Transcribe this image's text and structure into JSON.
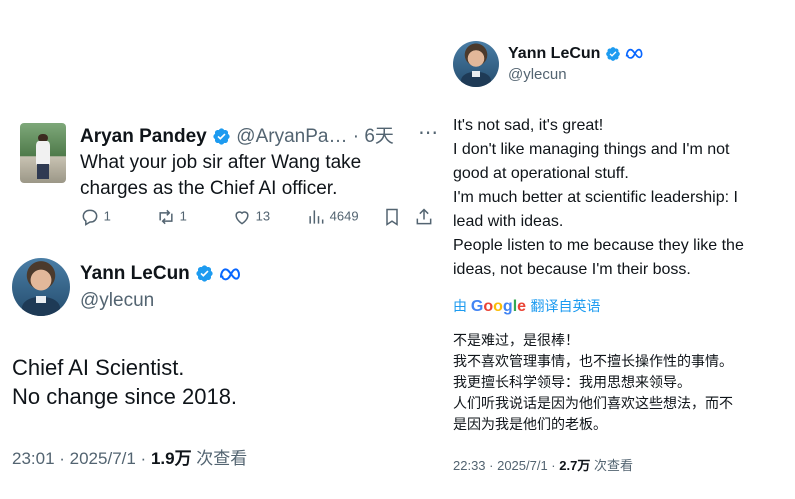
{
  "left": {
    "reply": {
      "name": "Aryan Pandey",
      "handle_time": "@AryanPa… · 6天",
      "text_line1": "What your job sir after Wang take",
      "text_line2": "charges as the Chief AI officer.",
      "stats": {
        "replies": "1",
        "reposts": "1",
        "likes": "13",
        "views": "4649"
      }
    },
    "main": {
      "name": "Yann LeCun",
      "handle": "@ylecun",
      "text_line1": "Chief AI Scientist.",
      "text_line2": "No change since 2018.",
      "meta_time": "23:01 · 2025/7/1 · ",
      "meta_views": "1.9万",
      "meta_suffix": " 次查看"
    }
  },
  "right": {
    "name": "Yann LeCun",
    "handle": "@ylecun",
    "lines": [
      "It's not sad, it's great!",
      "I don't like managing things and I'm not",
      "good at operational stuff.",
      "I'm much better at scientific leadership: I",
      "lead with ideas.",
      "People listen to me because they like the",
      "ideas, not because I'm their boss."
    ],
    "translate": {
      "prefix": "由",
      "google": "Google",
      "suffix": "翻译自英语"
    },
    "translated_lines": [
      "不是难过，是很棒！",
      "我不喜欢管理事情，也不擅长操作性的事情。",
      "我更擅长科学领导：我用思想来领导。",
      "人们听我说话是因为他们喜欢这些想法，而不",
      "是因为我是他们的老板。"
    ],
    "meta_time": "22:33 · 2025/7/1 · ",
    "meta_views": "2.7万",
    "meta_suffix": " 次查看"
  },
  "colors": {
    "verified": "#1d9bf0",
    "meta_blue": "#0866ff",
    "link": "#1d9bf0"
  },
  "icons": [
    "verified-badge-icon",
    "meta-logo-icon",
    "reply-icon",
    "repost-icon",
    "like-icon",
    "views-icon",
    "bookmark-icon",
    "share-icon",
    "more-icon"
  ]
}
